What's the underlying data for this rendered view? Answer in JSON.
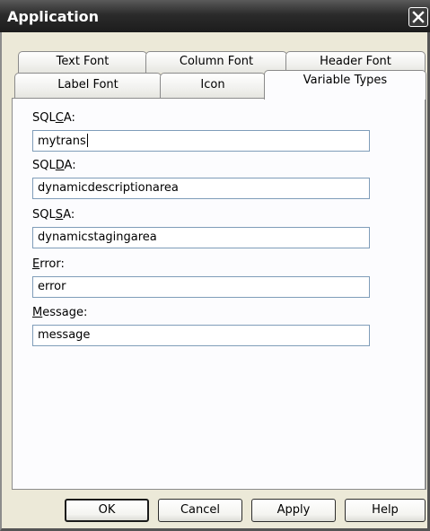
{
  "window": {
    "title": "Application"
  },
  "tabs": {
    "row1": [
      {
        "label": "Text Font"
      },
      {
        "label": "Column Font"
      },
      {
        "label": "Header Font"
      }
    ],
    "row2": [
      {
        "label": "Label Font"
      },
      {
        "label": "Icon"
      },
      {
        "label": "Variable Types",
        "active": true
      }
    ]
  },
  "fields": [
    {
      "label": "SQLCA:",
      "mnemonic": "C",
      "value": "mytrans",
      "focused": true
    },
    {
      "label": "SQLDA:",
      "mnemonic": "D",
      "value": "dynamicdescriptionarea"
    },
    {
      "label": "SQLSA:",
      "mnemonic": "S",
      "value": "dynamicstagingarea"
    },
    {
      "label": "Error:",
      "mnemonic": "E",
      "value": "error"
    },
    {
      "label": "Message:",
      "mnemonic": "M",
      "value": "message"
    }
  ],
  "buttons": {
    "ok": "OK",
    "cancel": "Cancel",
    "apply": "Apply",
    "help": "Help"
  },
  "icons": {
    "close": "close-icon"
  }
}
